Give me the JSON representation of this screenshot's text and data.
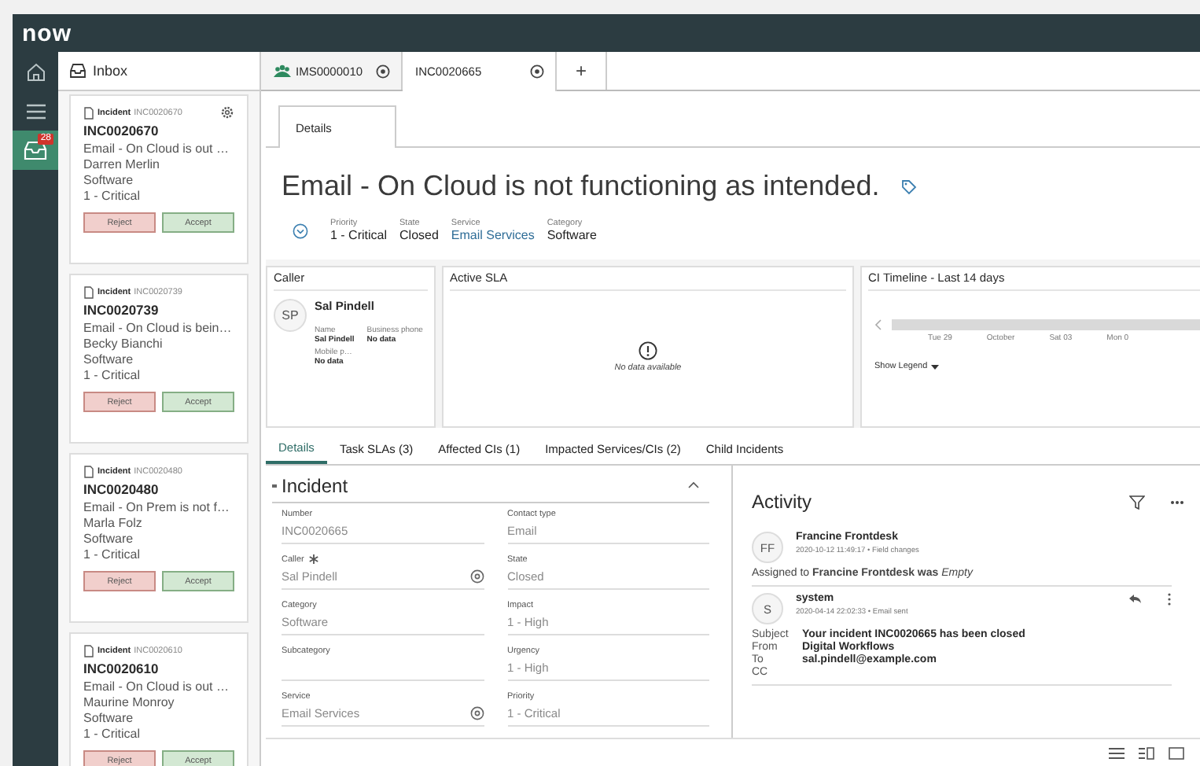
{
  "app": {
    "logo": "now"
  },
  "rail": [
    {
      "kind": "home",
      "selected": false
    },
    {
      "kind": "list",
      "selected": false
    },
    {
      "kind": "inbox",
      "selected": true,
      "badge": "28"
    }
  ],
  "inbox": {
    "title": "Inbox",
    "cards": [
      {
        "type": "Incident",
        "ref": "INC0020670",
        "number": "INC0020670",
        "title": "Email - On Cloud is out …",
        "caller": "Darren Merlin",
        "category": "Software",
        "priority": "1 - Critical",
        "settings": true,
        "reject": "Reject",
        "accept": "Accept"
      },
      {
        "type": "Incident",
        "ref": "INC0020739",
        "number": "INC0020739",
        "title": "Email - On Cloud is bein…",
        "caller": "Becky Bianchi",
        "category": "Software",
        "priority": "1 - Critical",
        "settings": false,
        "reject": "Reject",
        "accept": "Accept"
      },
      {
        "type": "Incident",
        "ref": "INC0020480",
        "number": "INC0020480",
        "title": "Email - On Prem is not f…",
        "caller": "Marla Folz",
        "category": "Software",
        "priority": "1 - Critical",
        "settings": false,
        "reject": "Reject",
        "accept": "Accept"
      },
      {
        "type": "Incident",
        "ref": "INC0020610",
        "number": "INC0020610",
        "title": "Email - On Cloud is out …",
        "caller": "Maurine Monroy",
        "category": "Software",
        "priority": "1 - Critical",
        "settings": false,
        "reject": "Reject",
        "accept": "Accept"
      }
    ]
  },
  "tabs": [
    {
      "label": "IMS0000010",
      "kind": "workspace",
      "selected": false
    },
    {
      "label": "INC0020665",
      "kind": "record",
      "selected": true
    }
  ],
  "add_tab": "+",
  "form_tab": "Details",
  "record": {
    "title": "Email - On Cloud is not functioning as intended.",
    "meta": [
      {
        "label": "Priority",
        "value": "1 - Critical",
        "link": false
      },
      {
        "label": "State",
        "value": "Closed",
        "link": false
      },
      {
        "label": "Service",
        "value": "Email Services",
        "link": true
      },
      {
        "label": "Category",
        "value": "Software",
        "link": false
      }
    ]
  },
  "caller_card": {
    "title": "Caller",
    "initials": "SP",
    "name": "Sal Pindell",
    "fields": [
      {
        "label": "Name",
        "value": "Sal Pindell"
      },
      {
        "label": "Business phone",
        "value": "No data"
      },
      {
        "label": "Mobile p…",
        "value": "No data"
      }
    ]
  },
  "sla_card": {
    "title": "Active SLA",
    "empty": "No data available"
  },
  "timeline": {
    "title": "CI Timeline - Last 14 days",
    "dates": [
      "Tue 29",
      "October",
      "Sat 03",
      "Mon 0"
    ],
    "legend": "Show Legend"
  },
  "related_tabs": [
    {
      "label": "Details",
      "selected": true
    },
    {
      "label": "Task SLAs (3)",
      "selected": false
    },
    {
      "label": "Affected CIs (1)",
      "selected": false
    },
    {
      "label": "Impacted Services/CIs (2)",
      "selected": false
    },
    {
      "label": "Child Incidents",
      "selected": false
    }
  ],
  "section": {
    "title": "Incident",
    "expanded": true,
    "fields": [
      {
        "label": "Number",
        "value": "INC0020665"
      },
      {
        "label": "Contact type",
        "value": "Email"
      },
      {
        "label": "Caller",
        "value": "Sal Pindell",
        "required": true,
        "lookup": true
      },
      {
        "label": "State",
        "value": "Closed"
      },
      {
        "label": "Category",
        "value": "Software"
      },
      {
        "label": "Impact",
        "value": "1 - High"
      },
      {
        "label": "Subcategory"
      },
      {
        "label": "Urgency",
        "value": "1 - High"
      },
      {
        "label": "Service",
        "value": "Email Services",
        "lookup": true
      },
      {
        "label": "Priority",
        "value": "1 - Critical"
      }
    ]
  },
  "activity": {
    "title": "Activity",
    "entries": [
      {
        "kind": "field_change",
        "initials": "FF",
        "author": "Francine Frontdesk",
        "meta": "2020-10-12 11:49:17 • Field changes",
        "text": "Assigned to  **Francine Frontdesk was** *Empty*"
      },
      {
        "kind": "email",
        "initials": "S",
        "author": "system",
        "meta": "2020-04-14 22:02:33 • Email sent",
        "rows": [
          {
            "label": "Subject",
            "value": "Your incident INC0020665 has been closed"
          },
          {
            "label": "From",
            "value": "Digital Workflows"
          },
          {
            "label": "To",
            "value": "sal.pindell@example.com"
          },
          {
            "label": "CC"
          }
        ]
      }
    ]
  }
}
